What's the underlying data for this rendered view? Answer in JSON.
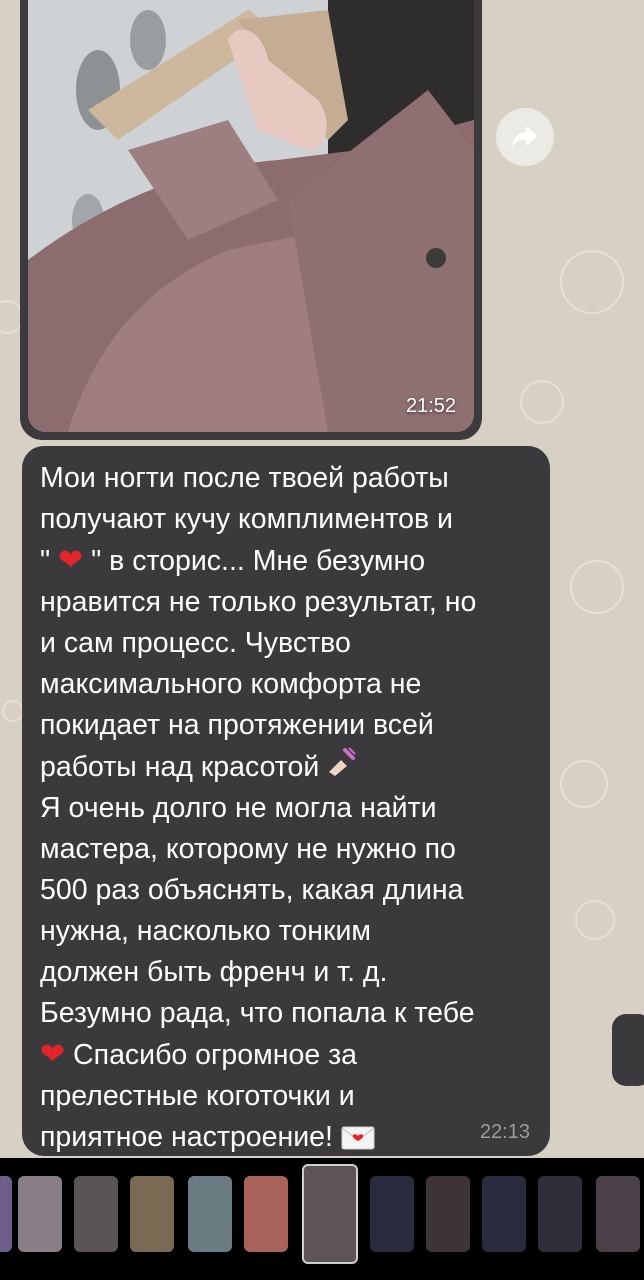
{
  "photo_message": {
    "time": "21:52",
    "forward_icon": "forward-arrow-icon"
  },
  "text_message": {
    "line_1": "Мои ногти после твоей работы",
    "line_2": "получают кучу комплиментов и",
    "line_3_a": "\" ",
    "line_3_b": " \" в сторис... Мне безумно",
    "line_4": "нравится не только результат, но",
    "line_5": "и сам процесс. Чувство",
    "line_6": "максимального комфорта не",
    "line_7": "покидает на протяжении всей",
    "line_8": "работы над красотой ",
    "line_9": "Я очень долго не могла найти",
    "line_10": "мастера, которому не нужно по",
    "line_11": "500 раз объяснять, какая длина",
    "line_12": "нужна, насколько тонким",
    "line_13": "должен быть френч и т. д.",
    "line_14": "Безумно рада, что попала к тебе",
    "line_15": " Спасибо огромное за",
    "line_16": "прелестные коготочки и",
    "line_17": "приятное настроение! ",
    "time": "22:13",
    "heart_icon": "heart-emoji-icon",
    "nail_icon": "nail-polish-emoji-icon",
    "envelope_icon": "love-letter-emoji-icon"
  },
  "colors": {
    "bubble": "#3a3a3c",
    "text": "#ffffff",
    "time": "#9b9ba0",
    "heart": "#e3242b",
    "chat_background": "#d6d1c4"
  }
}
